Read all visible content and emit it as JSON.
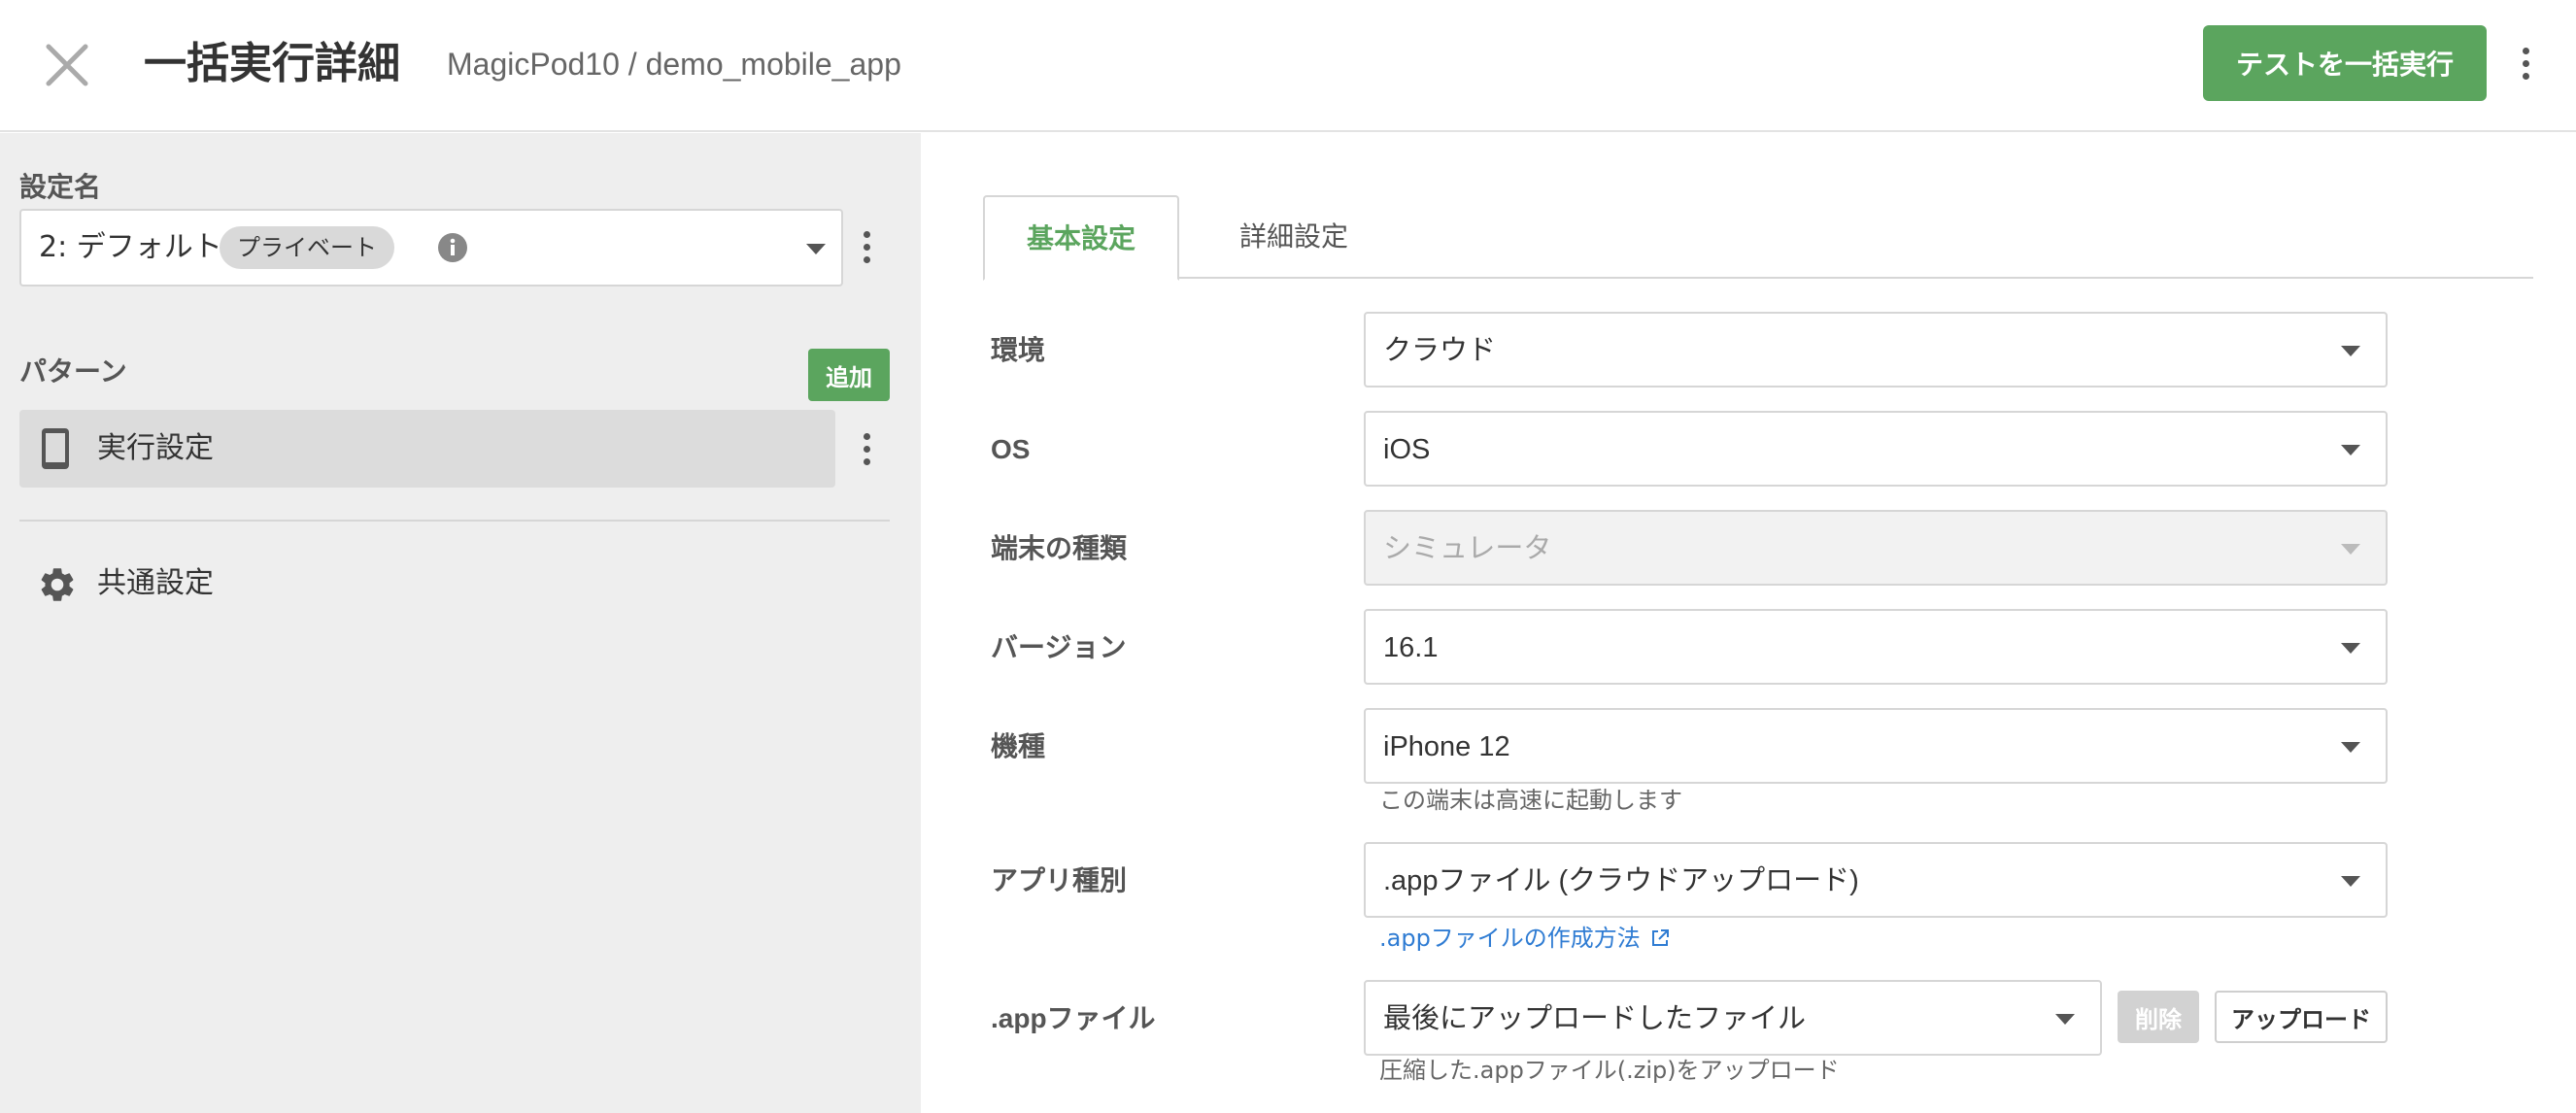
{
  "header": {
    "title": "一括実行詳細",
    "breadcrumb": "MagicPod10 / demo_mobile_app",
    "run_button_label": "テストを一括実行"
  },
  "sidebar": {
    "setting_name_label": "設定名",
    "config": {
      "name": "2: デフォルト",
      "badge": "プライベート"
    },
    "pattern_label": "パターン",
    "add_button_label": "追加",
    "pattern_item_label": "実行設定",
    "common_settings_label": "共通設定"
  },
  "main": {
    "tabs": [
      {
        "label": "基本設定",
        "active": true
      },
      {
        "label": "詳細設定",
        "active": false
      }
    ],
    "rows": {
      "environment": {
        "label": "環境",
        "value": "クラウド"
      },
      "os": {
        "label": "OS",
        "value": "iOS"
      },
      "device_type": {
        "label": "端末の種類",
        "value": "シミュレータ",
        "disabled": true
      },
      "version": {
        "label": "バージョン",
        "value": "16.1"
      },
      "model": {
        "label": "機種",
        "value": "iPhone 12",
        "hint": "この端末は高速に起動します"
      },
      "app_type": {
        "label": "アプリ種別",
        "value": ".appファイル (クラウドアップロード)",
        "link": ".appファイルの作成方法"
      },
      "app_file": {
        "label": ".appファイル",
        "value": "最後にアップロードしたファイル",
        "delete_label": "削除",
        "upload_label": "アップロード",
        "hint": "圧縮した.appファイル(.zip)をアップロード"
      }
    }
  },
  "colors": {
    "accent_green": "#5ba55e",
    "link_blue": "#2f7cd3",
    "sidebar_bg": "#eeeeee"
  },
  "icons": [
    "close-icon",
    "kebab-icon",
    "info-icon",
    "chevron-down-icon",
    "phone-icon",
    "gear-icon",
    "external-link-icon"
  ]
}
